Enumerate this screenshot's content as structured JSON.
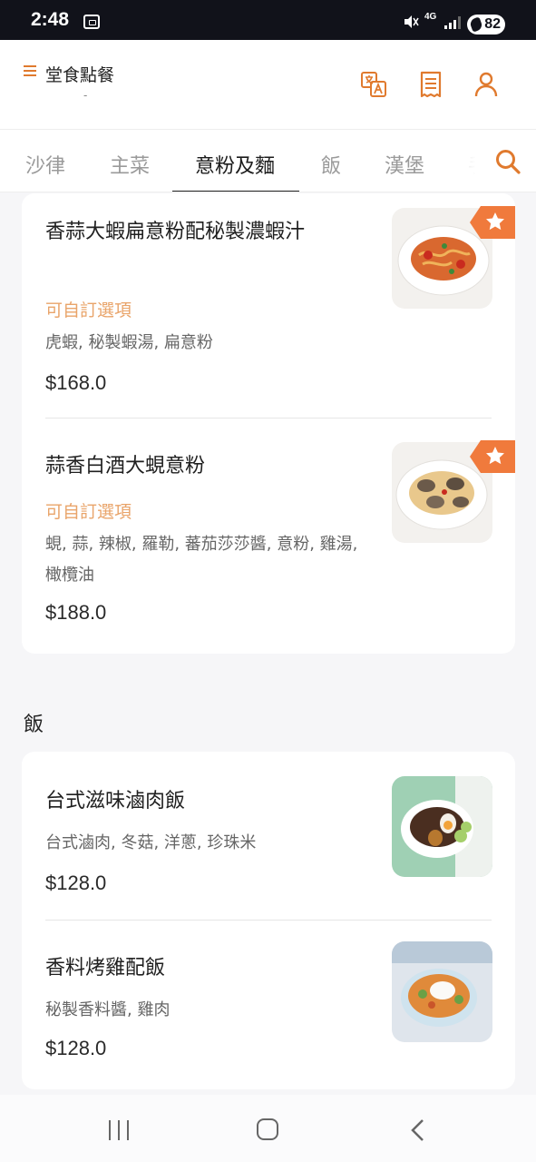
{
  "status_bar": {
    "time": "2:48",
    "network": "4G",
    "battery": "82"
  },
  "header": {
    "title": "堂食點餐",
    "subtitle": "-",
    "icons": [
      "menu-icon",
      "translate-icon",
      "receipt-icon",
      "user-icon"
    ]
  },
  "tabs": [
    {
      "label": "沙律",
      "active": false
    },
    {
      "label": "主菜",
      "active": false
    },
    {
      "label": "意粉及麵",
      "active": true
    },
    {
      "label": "飯",
      "active": false
    },
    {
      "label": "漢堡",
      "active": false
    },
    {
      "label": "手",
      "active": false
    }
  ],
  "pasta_items": [
    {
      "name": "香蒜大蝦扁意粉配秘製濃蝦汁",
      "option": "可自訂選項",
      "description": "虎蝦, 秘製蝦湯, 扁意粉",
      "price": "$168.0",
      "favorite": true
    },
    {
      "name": "蒜香白酒大蜆意粉",
      "option": "可自訂選項",
      "description": "蜆, 蒜, 辣椒, 羅勒, 蕃茄莎莎醬, 意粉, 雞湯, 橄欖油",
      "price": "$188.0",
      "favorite": true
    }
  ],
  "rice_section": {
    "title": "飯",
    "items": [
      {
        "name": "台式滋味滷肉飯",
        "description": "台式滷肉, 冬菇, 洋蔥, 珍珠米",
        "price": "$128.0"
      },
      {
        "name": "香料烤雞配飯",
        "description": "秘製香料醬, 雞肉",
        "price": "$128.0"
      }
    ]
  },
  "colors": {
    "accent": "#e07a2e",
    "option_text": "#e9a46a",
    "badge": "#f07a3c"
  }
}
